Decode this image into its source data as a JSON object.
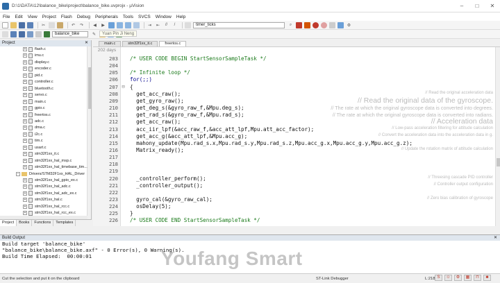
{
  "window": {
    "title": "D:\\1\\DATA\\12\\balance_bike\\project\\balance_bike.uvprojx - µVision",
    "controls": [
      "–",
      "□",
      "✕"
    ]
  },
  "menu": [
    "File",
    "Edit",
    "View",
    "Project",
    "Flash",
    "Debug",
    "Peripherals",
    "Tools",
    "SVCS",
    "Window",
    "Help"
  ],
  "toolbar": {
    "target": "balance_bike",
    "find_combo": "timer_ticks"
  },
  "tooltip": "Yuan Pin Ji Neng",
  "project_panel": {
    "title": "Project",
    "tree": [
      {
        "label": "flash.c",
        "type": "file",
        "level": 2
      },
      {
        "label": "imu.c",
        "type": "file",
        "level": 2
      },
      {
        "label": "display.c",
        "type": "file",
        "level": 2
      },
      {
        "label": "encoder.c",
        "type": "file",
        "level": 2
      },
      {
        "label": "pid.c",
        "type": "file",
        "level": 2
      },
      {
        "label": "controller.c",
        "type": "file",
        "level": 2
      },
      {
        "label": "bluetooth.c",
        "type": "file",
        "level": 2
      },
      {
        "label": "servo.c",
        "type": "file",
        "level": 2
      },
      {
        "label": "main.c",
        "type": "file",
        "level": 2
      },
      {
        "label": "gpio.c",
        "type": "file",
        "level": 2
      },
      {
        "label": "freertos.c",
        "type": "file",
        "level": 2
      },
      {
        "label": "adc.c",
        "type": "file",
        "level": 2
      },
      {
        "label": "dma.c",
        "type": "file",
        "level": 2
      },
      {
        "label": "i2c.c",
        "type": "file",
        "level": 2
      },
      {
        "label": "tim.c",
        "type": "file",
        "level": 2
      },
      {
        "label": "usart.c",
        "type": "file",
        "level": 2
      },
      {
        "label": "stm32f1xx_it.c",
        "type": "file",
        "level": 2
      },
      {
        "label": "stm32f1xx_hal_msp.c",
        "type": "file",
        "level": 2
      },
      {
        "label": "stm32f1xx_hal_timebase_tim...",
        "type": "file",
        "level": 2
      },
      {
        "label": "Drivers/STM32F1xx_HAL_Driver",
        "type": "folder",
        "level": 1
      },
      {
        "label": "stm32f1xx_hal_gpio_ex.c",
        "type": "file",
        "level": 2
      },
      {
        "label": "stm32f1xx_hal_adc.c",
        "type": "file",
        "level": 2
      },
      {
        "label": "stm32f1xx_hal_adc_ex.c",
        "type": "file",
        "level": 2
      },
      {
        "label": "stm32f1xx_hal.c",
        "type": "file",
        "level": 2
      },
      {
        "label": "stm32f1xx_hal_rcc.c",
        "type": "file",
        "level": 2
      },
      {
        "label": "stm32f1xx_hal_rcc_ex.c",
        "type": "file",
        "level": 2
      }
    ],
    "bottom_tabs": [
      "Project",
      "Books",
      "Functions",
      "Templates"
    ]
  },
  "editor": {
    "tabs": [
      "main.c",
      "stm32f1xx_it.c",
      "freertos.c"
    ],
    "active_tab": "freertos.c",
    "gutter_label": "202 days",
    "lines": [
      {
        "n": "203",
        "text": "/* USER CODE BEGIN StartSensorSampleTask */",
        "style": "comment"
      },
      {
        "n": "204",
        "text": "",
        "style": "code"
      },
      {
        "n": "205",
        "text": "/* Infinite loop */",
        "style": "comment"
      },
      {
        "n": "206",
        "text": "for(;;)",
        "style": "kw"
      },
      {
        "n": "207",
        "text": "{",
        "style": "code",
        "marker": "⊟"
      },
      {
        "n": "208",
        "text": "  get_acc_raw();",
        "style": "code"
      },
      {
        "n": "209",
        "text": "  get_gyro_raw();",
        "style": "code"
      },
      {
        "n": "210",
        "text": "  get_deg_s(&gyro_raw_f,&Mpu.deg_s);",
        "style": "code"
      },
      {
        "n": "211",
        "text": "  get_rad_s(&gyro_raw_f,&Mpu.rad_s);",
        "style": "code"
      },
      {
        "n": "212",
        "text": "  get_acc_raw();",
        "style": "code"
      },
      {
        "n": "213",
        "text": "  acc_iir_lpf(&acc_raw_f,&acc_att_lpf,Mpu.att_acc_factor);",
        "style": "code"
      },
      {
        "n": "214",
        "text": "  get_acc_g(&acc_att_lpf,&Mpu.acc_g);",
        "style": "code"
      },
      {
        "n": "215",
        "text": "  mahony_update(Mpu.rad_s.x,Mpu.rad_s.y,Mpu.rad_s.z,Mpu.acc_g.x,Mpu.acc_g.y,Mpu.acc_g.z);",
        "style": "code"
      },
      {
        "n": "216",
        "text": "  Matrix_ready();",
        "style": "code"
      },
      {
        "n": "217",
        "text": "",
        "style": "code"
      },
      {
        "n": "218",
        "text": "",
        "style": "code"
      },
      {
        "n": "219",
        "text": "",
        "style": "code"
      },
      {
        "n": "220",
        "text": "  _controller_perform();",
        "style": "code"
      },
      {
        "n": "221",
        "text": "  _controller_output();",
        "style": "code"
      },
      {
        "n": "222",
        "text": "",
        "style": "code"
      },
      {
        "n": "223",
        "text": "  gyro_cal(&gyro_raw_cal);",
        "style": "code"
      },
      {
        "n": "224",
        "text": "  osDelay(5);",
        "style": "code"
      },
      {
        "n": "225",
        "text": "}",
        "style": "code"
      },
      {
        "n": "226",
        "text": "/* USER CODE END StartSensorSampleTask */",
        "style": "comment"
      }
    ],
    "annotations": [
      {
        "text": "// Read the original acceleration data",
        "size": "small",
        "line": 208
      },
      {
        "text": "// Read the original data of the gyroscope.",
        "size": "large",
        "line": 209
      },
      {
        "text": "// The rate at which the original gyroscope data is converted into degrees.",
        "size": "medium",
        "line": 210
      },
      {
        "text": "// The rate at which the original gyroscope data is converted into radians.",
        "size": "medium",
        "line": 211
      },
      {
        "text": "// Acceleration data",
        "size": "large",
        "line": 212
      },
      {
        "text": "// Low-pass acceleration filtering for attitude calculation",
        "size": "small",
        "line": 213
      },
      {
        "text": "// Convert the acceleration data into the acceleration data in g.",
        "size": "small",
        "line": 214
      },
      {
        "text": "// Update the rotation matrix of attitude calculation",
        "size": "small",
        "line": 216
      },
      {
        "text": "// Threesing cascade PID controller",
        "size": "small",
        "line": 220
      },
      {
        "text": "// Controller output configuration",
        "size": "small",
        "line": 221
      },
      {
        "text": "// Zero bias calibration of gyroscope",
        "size": "small",
        "line": 223
      }
    ]
  },
  "build_output": {
    "title": "Build Output",
    "lines": [
      "Build target 'balance_bike'",
      "\"balance_bike\\balance_bike.axf\" - 0 Error(s), 0 Warning(s).",
      "Build Time Elapsed:  00:00:01"
    ]
  },
  "watermark": "Youfang Smart",
  "status": {
    "hint": "Cut the selection and put it on the clipboard",
    "debugger": "ST-Link Debugger",
    "position": "L:218 C:"
  }
}
